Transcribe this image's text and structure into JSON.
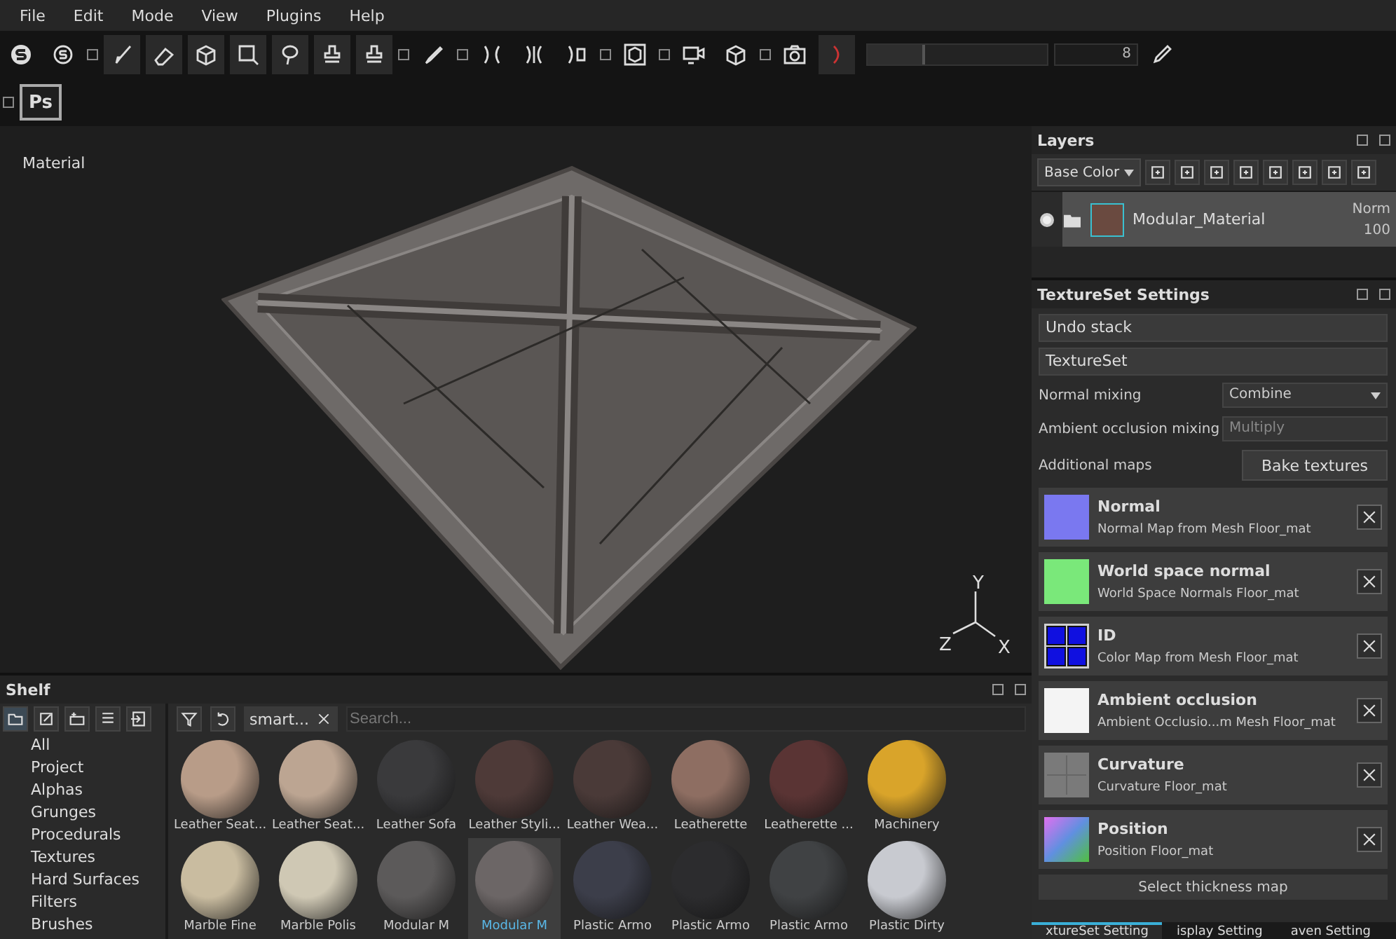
{
  "menu": [
    "File",
    "Edit",
    "Mode",
    "View",
    "Plugins",
    "Help"
  ],
  "toolbar": {
    "brush_size": "8",
    "brush_slider": {
      "level": 0.32
    },
    "ps_label": "Ps"
  },
  "viewport": {
    "label": "Material",
    "axes": [
      "Y",
      "Z",
      "X"
    ]
  },
  "shelf": {
    "title": "Shelf",
    "filter_tag": "smart...",
    "search": {
      "placeholder": "Search..."
    },
    "categories": [
      {
        "label": "All",
        "selected": false
      },
      {
        "label": "Project",
        "selected": false
      },
      {
        "label": "Alphas",
        "selected": false
      },
      {
        "label": "Grunges",
        "selected": false
      },
      {
        "label": "Procedurals",
        "selected": false
      },
      {
        "label": "Textures",
        "selected": false
      },
      {
        "label": "Hard Surfaces",
        "selected": false
      },
      {
        "label": "Filters",
        "selected": false
      },
      {
        "label": "Brushes",
        "selected": false
      }
    ],
    "materials": [
      {
        "name": "Leather Seat...",
        "color": "#b89c88",
        "selected": false
      },
      {
        "name": "Leather Seat...",
        "color": "#bca592",
        "selected": false
      },
      {
        "name": "Leather Sofa",
        "color": "#3a3a3c",
        "selected": false
      },
      {
        "name": "Leather Styli...",
        "color": "#4e3a38",
        "selected": false
      },
      {
        "name": "Leather Wea...",
        "color": "#4a3a38",
        "selected": false
      },
      {
        "name": "Leatherette",
        "color": "#8e6e62",
        "selected": false
      },
      {
        "name": "Leatherette ...",
        "color": "#5a3434",
        "selected": false
      },
      {
        "name": "Machinery",
        "color": "#d9a42a",
        "selected": false
      },
      {
        "name": "Marble Fine",
        "color": "#c9bca0",
        "selected": false
      },
      {
        "name": "Marble Polis",
        "color": "#cfc8b4",
        "selected": false
      },
      {
        "name": "Modular M",
        "color": "#5c5a5a",
        "selected": false
      },
      {
        "name": "Modular M",
        "color": "#6c6666",
        "selected": true
      },
      {
        "name": "Plastic Armo",
        "color": "#3c3e4a",
        "selected": false
      },
      {
        "name": "Plastic Armo",
        "color": "#2c2c2e",
        "selected": false
      },
      {
        "name": "Plastic Armo",
        "color": "#404244",
        "selected": false
      },
      {
        "name": "Plastic Dirty",
        "color": "#c8cad0",
        "selected": false
      }
    ]
  },
  "layers": {
    "title": "Layers",
    "channel": "Base Color",
    "items": [
      {
        "name": "Modular_Material",
        "visible": true,
        "blend": "Norm",
        "opacity": "100"
      }
    ]
  },
  "textureset_settings": {
    "title": "TextureSet Settings",
    "sections": [
      "Undo stack",
      "TextureSet"
    ],
    "fields": [
      {
        "label": "Normal mixing",
        "value": "Combine",
        "kind": "dropdown"
      },
      {
        "label": "Ambient occlusion mixing",
        "value": "Multiply",
        "kind": "field"
      }
    ],
    "additional_maps": {
      "label": "Additional maps",
      "button": "Bake textures"
    },
    "maps": [
      {
        "title": "Normal",
        "subtitle": "Normal Map from Mesh Floor_mat",
        "kind": "normal"
      },
      {
        "title": "World space normal",
        "subtitle": "World Space Normals Floor_mat",
        "kind": "world"
      },
      {
        "title": "ID",
        "subtitle": "Color Map from Mesh Floor_mat",
        "kind": "id"
      },
      {
        "title": "Ambient occlusion",
        "subtitle": "Ambient Occlusio...m Mesh Floor_mat",
        "kind": "ao"
      },
      {
        "title": "Curvature",
        "subtitle": "Curvature Floor_mat",
        "kind": "curvature"
      },
      {
        "title": "Position",
        "subtitle": "Position Floor_mat",
        "kind": "position"
      }
    ],
    "thickness_button": "Select thickness map"
  },
  "bottom_tabs": [
    {
      "label": "xtureSet Setting",
      "selected": true
    },
    {
      "label": "isplay Setting",
      "selected": false
    },
    {
      "label": "aven Setting",
      "selected": false
    }
  ]
}
